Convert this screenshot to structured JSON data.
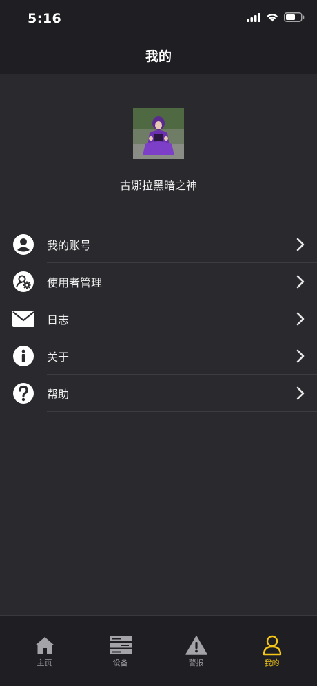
{
  "status_bar": {
    "time": "5:16"
  },
  "header": {
    "title": "我的"
  },
  "profile": {
    "username": "古娜拉黑暗之神"
  },
  "menu": {
    "items": [
      {
        "label": "我的账号",
        "icon": "account-icon"
      },
      {
        "label": "使用者管理",
        "icon": "user-settings-icon"
      },
      {
        "label": "日志",
        "icon": "mail-icon"
      },
      {
        "label": "关于",
        "icon": "info-icon"
      },
      {
        "label": "帮助",
        "icon": "help-icon"
      }
    ]
  },
  "tab_bar": {
    "tabs": [
      {
        "label": "主页",
        "icon": "home-icon",
        "active": false
      },
      {
        "label": "设备",
        "icon": "device-icon",
        "active": false
      },
      {
        "label": "警报",
        "icon": "alert-icon",
        "active": false
      },
      {
        "label": "我的",
        "icon": "profile-icon",
        "active": true
      }
    ]
  },
  "colors": {
    "background": "#2a292e",
    "bar": "#1f1f23",
    "accent": "#f5c518",
    "inactive": "#9a9a9f"
  }
}
